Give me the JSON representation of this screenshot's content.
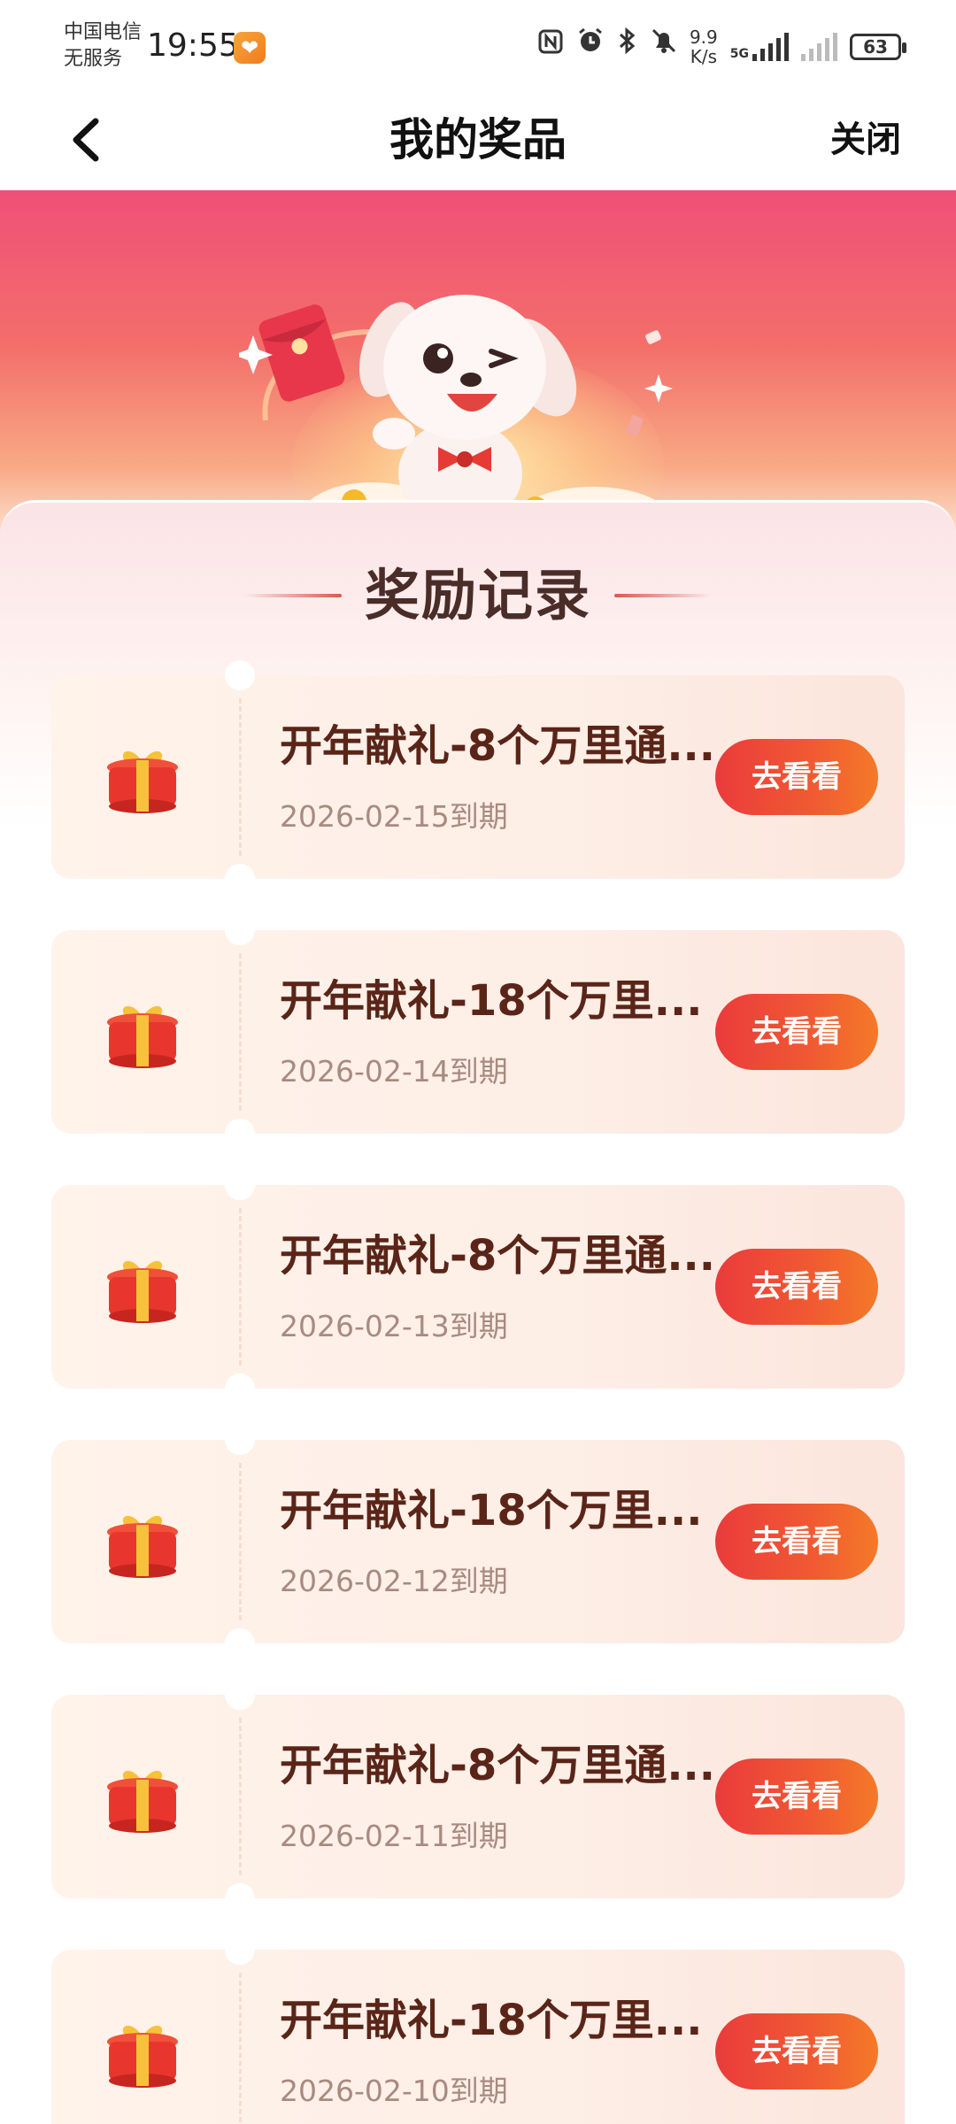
{
  "status_bar": {
    "carrier_line1": "中国电信",
    "carrier_line2": "无服务",
    "time": "19:55",
    "net_speed_value": "9.9",
    "net_speed_unit": "K/s",
    "network_type": "5G",
    "battery_level": "63"
  },
  "header": {
    "title": "我的奖品",
    "close_label": "关闭"
  },
  "section": {
    "title": "奖励记录"
  },
  "rewards": [
    {
      "title": "开年献礼-8个万里通...",
      "date": "2026-02-15到期",
      "button": "去看看"
    },
    {
      "title": "开年献礼-18个万里...",
      "date": "2026-02-14到期",
      "button": "去看看"
    },
    {
      "title": "开年献礼-8个万里通...",
      "date": "2026-02-13到期",
      "button": "去看看"
    },
    {
      "title": "开年献礼-18个万里...",
      "date": "2026-02-12到期",
      "button": "去看看"
    },
    {
      "title": "开年献礼-8个万里通...",
      "date": "2026-02-11到期",
      "button": "去看看"
    },
    {
      "title": "开年献礼-18个万里...",
      "date": "2026-02-10到期",
      "button": "去看看"
    }
  ],
  "colors": {
    "accent": "#ea3b3c",
    "title_text": "#5a2518",
    "date_text": "#a88a80",
    "banner_top": "#ef4f78"
  },
  "icons": {
    "back": "chevron-left-icon",
    "gift": "gift-box-icon",
    "nfc": "nfc-icon",
    "alarm": "alarm-icon",
    "bluetooth": "bluetooth-icon",
    "mute": "bell-off-icon"
  }
}
